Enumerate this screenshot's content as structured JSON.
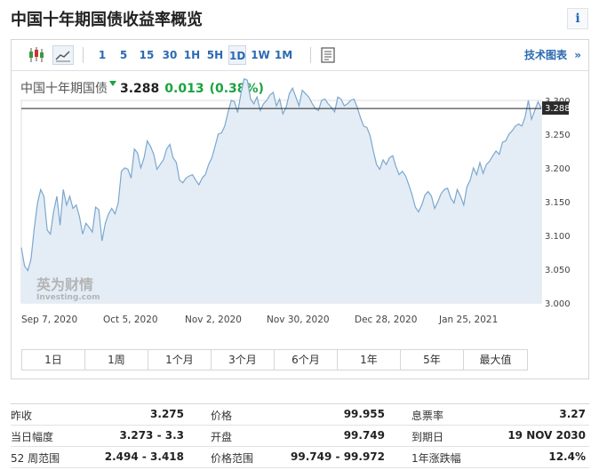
{
  "page": {
    "title": "中国十年期国债收益率概览",
    "info_icon": "i"
  },
  "toolbar": {
    "icons": [
      "candlestick-icon",
      "area-chart-icon",
      "settings-panel-icon"
    ],
    "timeframes": [
      "1",
      "5",
      "15",
      "30",
      "1H",
      "5H",
      "1D",
      "1W",
      "1M"
    ],
    "active_timeframe": "1D",
    "tech_link": "技术图表",
    "tech_arrow": "»"
  },
  "quote": {
    "name": "中国十年期国债",
    "price": "3.288",
    "change": "0.013",
    "change_pct": "(0.38%)"
  },
  "chart_data": {
    "type": "area",
    "current_label": "3.288",
    "current_value": 3.288,
    "y_ticks": [
      "3.000",
      "3.050",
      "3.100",
      "3.150",
      "3.200",
      "3.250",
      "3.300"
    ],
    "ylim": [
      3.0,
      3.3
    ],
    "x_ticks": [
      "Sep 7, 2020",
      "Oct 5, 2020",
      "Nov 2, 2020",
      "Nov 30, 2020",
      "Dec 28, 2020",
      "Jan 25, 2021"
    ],
    "watermark_cn": "英为财情",
    "watermark_en": "Investing.com",
    "color": "#7ba7cf",
    "fill": "#e4edf6",
    "values": [
      3.082,
      3.055,
      3.048,
      3.065,
      3.11,
      3.148,
      3.168,
      3.158,
      3.108,
      3.102,
      3.135,
      3.158,
      3.115,
      3.168,
      3.145,
      3.158,
      3.14,
      3.145,
      3.128,
      3.102,
      3.118,
      3.112,
      3.105,
      3.142,
      3.138,
      3.092,
      3.118,
      3.132,
      3.14,
      3.132,
      3.148,
      3.195,
      3.2,
      3.198,
      3.185,
      3.228,
      3.222,
      3.2,
      3.215,
      3.24,
      3.232,
      3.22,
      3.198,
      3.205,
      3.212,
      3.228,
      3.235,
      3.215,
      3.208,
      3.182,
      3.178,
      3.185,
      3.188,
      3.19,
      3.182,
      3.175,
      3.185,
      3.19,
      3.205,
      3.215,
      3.232,
      3.25,
      3.252,
      3.262,
      3.282,
      3.3,
      3.298,
      3.282,
      3.31,
      3.332,
      3.33,
      3.302,
      3.295,
      3.305,
      3.285,
      3.295,
      3.3,
      3.308,
      3.312,
      3.292,
      3.302,
      3.28,
      3.29,
      3.31,
      3.318,
      3.305,
      3.292,
      3.315,
      3.31,
      3.305,
      3.296,
      3.288,
      3.285,
      3.3,
      3.302,
      3.295,
      3.29,
      3.283,
      3.305,
      3.302,
      3.292,
      3.295,
      3.3,
      3.302,
      3.29,
      3.275,
      3.262,
      3.26,
      3.248,
      3.225,
      3.205,
      3.198,
      3.212,
      3.205,
      3.215,
      3.218,
      3.202,
      3.19,
      3.195,
      3.188,
      3.175,
      3.16,
      3.142,
      3.135,
      3.145,
      3.16,
      3.165,
      3.158,
      3.14,
      3.15,
      3.162,
      3.168,
      3.17,
      3.155,
      3.148,
      3.168,
      3.158,
      3.145,
      3.172,
      3.182,
      3.2,
      3.19,
      3.208,
      3.192,
      3.205,
      3.21,
      3.218,
      3.225,
      3.22,
      3.238,
      3.24,
      3.25,
      3.255,
      3.262,
      3.265,
      3.262,
      3.275,
      3.3,
      3.272,
      3.285,
      3.298,
      3.288
    ]
  },
  "ranges": [
    "1日",
    "1周",
    "1个月",
    "3个月",
    "6个月",
    "1年",
    "5年",
    "最大值"
  ],
  "stats": [
    [
      {
        "label": "昨收",
        "value": "3.275"
      },
      {
        "label": "价格",
        "value": "99.955"
      },
      {
        "label": "息票率",
        "value": "3.27"
      }
    ],
    [
      {
        "label": "当日幅度",
        "value": "3.273 - 3.3"
      },
      {
        "label": "开盘",
        "value": "99.749"
      },
      {
        "label": "到期日",
        "value": "19 NOV 2030"
      }
    ],
    [
      {
        "label": "52 周范围",
        "value": "2.494 - 3.418"
      },
      {
        "label": "价格范围",
        "value": "99.749 - 99.972"
      },
      {
        "label": "1年涨跌幅",
        "value": "12.4%"
      }
    ]
  ]
}
